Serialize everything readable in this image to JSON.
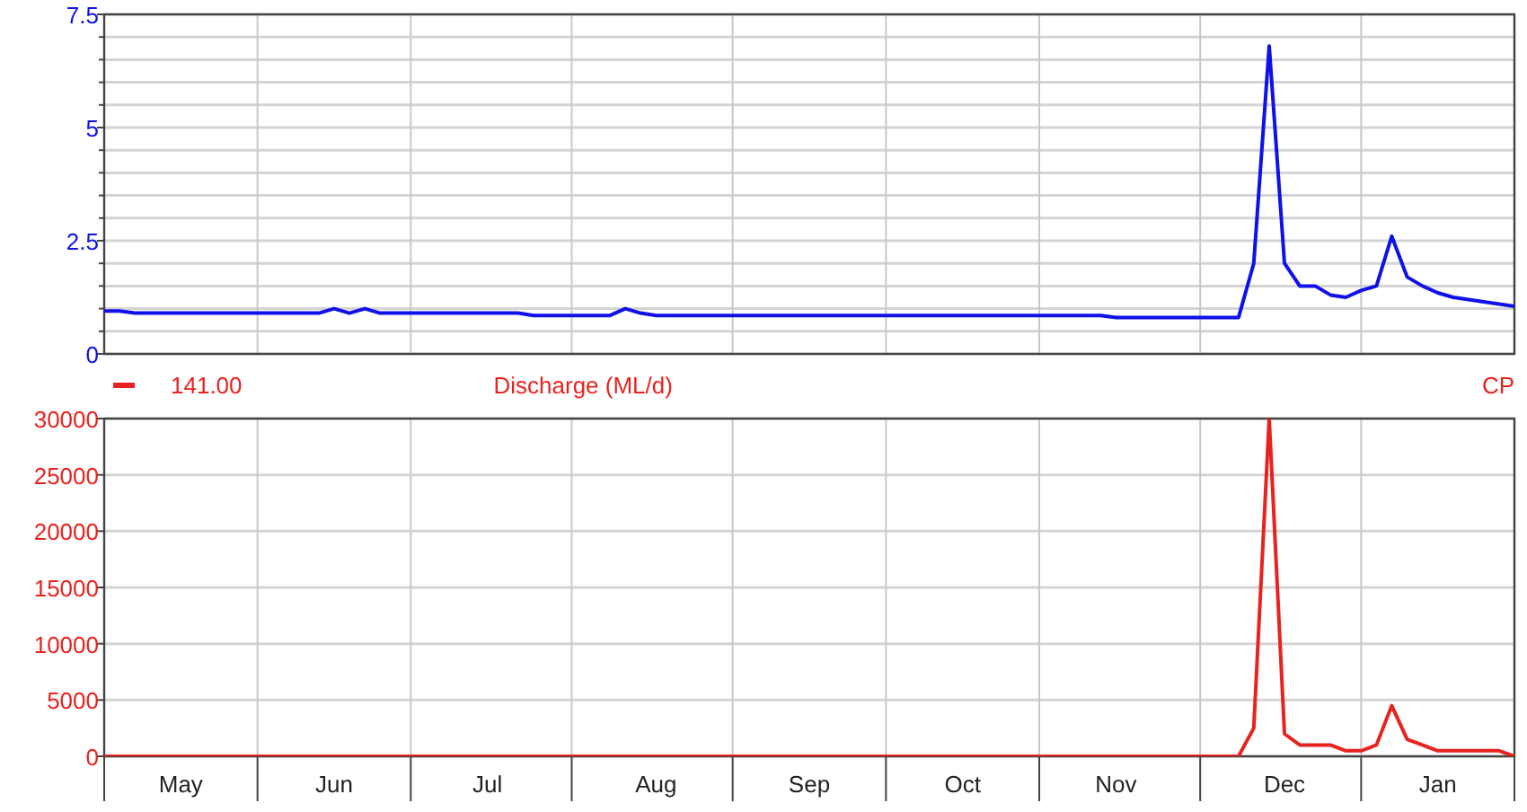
{
  "charts": [
    {
      "chart_data": {
        "type": "line",
        "grid": true,
        "ylim": [
          0,
          7.5
        ],
        "yticks": [
          0,
          2.5,
          5,
          7.5
        ],
        "series": [
          {
            "color": "#1010e8",
            "values": [
              0.95,
              0.95,
              0.9,
              0.9,
              0.9,
              0.9,
              0.9,
              0.9,
              0.9,
              0.9,
              0.9,
              0.9,
              0.9,
              0.9,
              0.9,
              1.0,
              0.9,
              1.0,
              0.9,
              0.9,
              0.9,
              0.9,
              0.9,
              0.9,
              0.9,
              0.9,
              0.9,
              0.9,
              0.85,
              0.85,
              0.85,
              0.85,
              0.85,
              0.85,
              1.0,
              0.9,
              0.85,
              0.85,
              0.85,
              0.85,
              0.85,
              0.85,
              0.85,
              0.85,
              0.85,
              0.85,
              0.85,
              0.85,
              0.85,
              0.85,
              0.85,
              0.85,
              0.85,
              0.85,
              0.85,
              0.85,
              0.85,
              0.85,
              0.85,
              0.85,
              0.85,
              0.85,
              0.85,
              0.85,
              0.85,
              0.85,
              0.8,
              0.8,
              0.8,
              0.8,
              0.8,
              0.8,
              0.8,
              0.8,
              0.8,
              2.0,
              6.8,
              2.0,
              1.5,
              1.5,
              1.3,
              1.25,
              1.4,
              1.5,
              2.6,
              1.7,
              1.5,
              1.35,
              1.25,
              1.2,
              1.15,
              1.1,
              1.05
            ]
          }
        ]
      }
    },
    {
      "legend": {
        "value": "141.00",
        "site": "CP"
      },
      "chart_data": {
        "type": "line",
        "grid": true,
        "title": "Discharge (ML/d)",
        "ylim": [
          0,
          30000
        ],
        "yticks": [
          0,
          5000,
          10000,
          15000,
          20000,
          25000,
          30000
        ],
        "categories": [
          null,
          null,
          null,
          null,
          null,
          "May",
          null,
          null,
          null,
          null,
          null,
          null,
          null,
          null,
          null,
          "Jun",
          null,
          null,
          null,
          null,
          null,
          null,
          null,
          null,
          null,
          "Jul",
          null,
          null,
          null,
          null,
          null,
          null,
          null,
          null,
          null,
          null,
          "Aug",
          null,
          null,
          null,
          null,
          null,
          null,
          null,
          null,
          null,
          "Sep",
          null,
          null,
          null,
          null,
          null,
          null,
          null,
          null,
          null,
          "Oct",
          null,
          null,
          null,
          null,
          null,
          null,
          null,
          null,
          null,
          "Nov",
          null,
          null,
          null,
          null,
          null,
          null,
          null,
          null,
          null,
          null,
          "Dec",
          null,
          null,
          null,
          null,
          null,
          null,
          null,
          null,
          null,
          "Jan",
          null,
          null,
          null,
          null,
          null
        ],
        "series": [
          {
            "color": "#e8231f",
            "values": [
              0,
              0,
              0,
              0,
              0,
              0,
              0,
              0,
              0,
              0,
              0,
              0,
              0,
              0,
              0,
              0,
              0,
              0,
              0,
              0,
              0,
              0,
              0,
              0,
              0,
              0,
              0,
              0,
              0,
              0,
              0,
              0,
              0,
              0,
              0,
              0,
              0,
              0,
              0,
              0,
              0,
              0,
              0,
              0,
              0,
              0,
              0,
              0,
              0,
              0,
              0,
              0,
              0,
              0,
              0,
              0,
              0,
              0,
              0,
              0,
              0,
              0,
              0,
              0,
              0,
              0,
              0,
              0,
              0,
              0,
              0,
              0,
              0,
              0,
              0,
              2500,
              30000,
              2000,
              1000,
              1000,
              1000,
              500,
              500,
              1000,
              4500,
              1500,
              1000,
              500,
              500,
              500,
              500,
              500,
              0
            ]
          }
        ]
      }
    }
  ]
}
